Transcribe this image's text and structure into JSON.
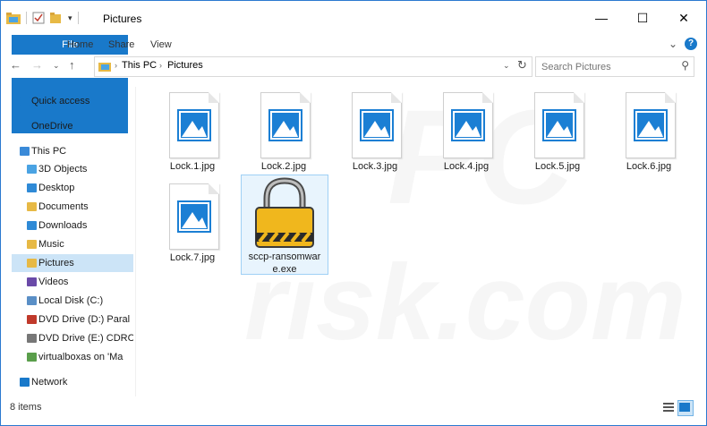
{
  "window": {
    "title": "Pictures"
  },
  "window_controls": {
    "minimize": "—",
    "maximize": "☐",
    "close": "✕"
  },
  "ribbon": {
    "tabs": [
      "File",
      "Home",
      "Share",
      "View"
    ],
    "help": "?"
  },
  "address": {
    "crumbs": [
      "This PC",
      "Pictures"
    ]
  },
  "search": {
    "placeholder": "Search Pictures"
  },
  "sidebar": {
    "items": [
      {
        "label": "Quick access",
        "icon": "star-icon",
        "color": "#1979ca"
      },
      {
        "label": "OneDrive",
        "icon": "cloud-icon",
        "color": "#1979ca"
      },
      {
        "label": "This PC",
        "icon": "computer-icon",
        "color": "#3a8ad8"
      },
      {
        "label": "3D Objects",
        "icon": "cube-icon",
        "color": "#4aa3e3"
      },
      {
        "label": "Desktop",
        "icon": "desktop-folder-icon",
        "color": "#2f8ad6"
      },
      {
        "label": "Documents",
        "icon": "documents-folder-icon",
        "color": "#e7b945"
      },
      {
        "label": "Downloads",
        "icon": "downloads-folder-icon",
        "color": "#2f8ad6"
      },
      {
        "label": "Music",
        "icon": "music-folder-icon",
        "color": "#e7b945"
      },
      {
        "label": "Pictures",
        "icon": "pictures-folder-icon",
        "color": "#e7b945",
        "selected": true
      },
      {
        "label": "Videos",
        "icon": "videos-folder-icon",
        "color": "#6a4aa8"
      },
      {
        "label": "Local Disk (C:)",
        "icon": "drive-icon",
        "color": "#5a8fc6"
      },
      {
        "label": "DVD Drive (D:) Paral",
        "icon": "dvd-icon",
        "color": "#c0392b"
      },
      {
        "label": "DVD Drive (E:) CDRC",
        "icon": "dvd-drive-icon",
        "color": "#777777"
      },
      {
        "label": "virtualboxas on 'Ma",
        "icon": "network-drive-icon",
        "color": "#5a9e4b"
      },
      {
        "label": "Network",
        "icon": "network-icon",
        "color": "#1979ca"
      }
    ]
  },
  "files": [
    {
      "name": "Lock.1.jpg",
      "type": "image"
    },
    {
      "name": "Lock.2.jpg",
      "type": "image"
    },
    {
      "name": "Lock.3.jpg",
      "type": "image"
    },
    {
      "name": "Lock.4.jpg",
      "type": "image"
    },
    {
      "name": "Lock.5.jpg",
      "type": "image"
    },
    {
      "name": "Lock.6.jpg",
      "type": "image"
    },
    {
      "name": "Lock.7.jpg",
      "type": "image"
    },
    {
      "name": "sccp-ransomwar\ne.exe",
      "type": "exe",
      "selected": true
    }
  ],
  "status": {
    "count": "8 items"
  },
  "colors": {
    "accent": "#1979ca",
    "selection": "#cce4f7",
    "image_icon": "#1b7fd4"
  }
}
